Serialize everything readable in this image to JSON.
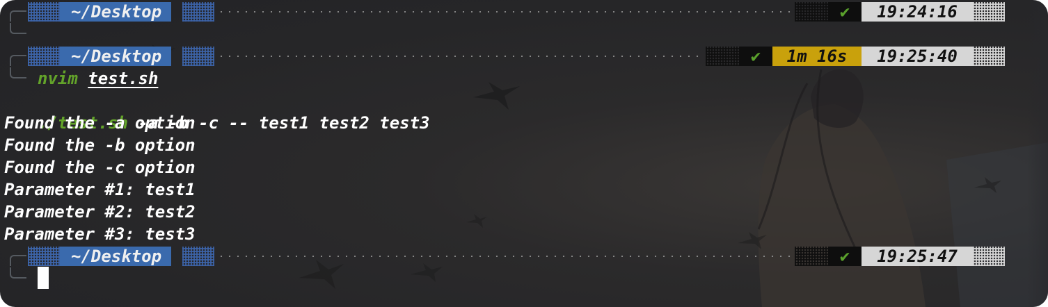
{
  "prompts": [
    {
      "dir": "~/Desktop",
      "status_icon": "✔",
      "duration": "",
      "time": "19:24:16",
      "command": {
        "program": "nvim",
        "args": "test.sh"
      }
    },
    {
      "dir": "~/Desktop",
      "status_icon": "✔",
      "duration": "1m 16s",
      "time": "19:25:40",
      "command": {
        "program": "./test.sh",
        "args": "-a -b -c -- test1 test2 test3"
      }
    },
    {
      "dir": "~/Desktop",
      "status_icon": "✔",
      "duration": "",
      "time": "19:25:47",
      "command": {
        "program": "",
        "args": ""
      }
    }
  ],
  "output": [
    "Found the -a option",
    "Found the -b option",
    "Found the -c option",
    "Parameter #1: test1",
    "Parameter #2: test2",
    "Parameter #3: test3"
  ],
  "colors": {
    "dir_bg": "#3a6aad",
    "ok_fg": "#5aa02c",
    "duration_bg": "#c9a10c",
    "time_bg": "#d6d6d6",
    "command_fg": "#63a32a"
  }
}
